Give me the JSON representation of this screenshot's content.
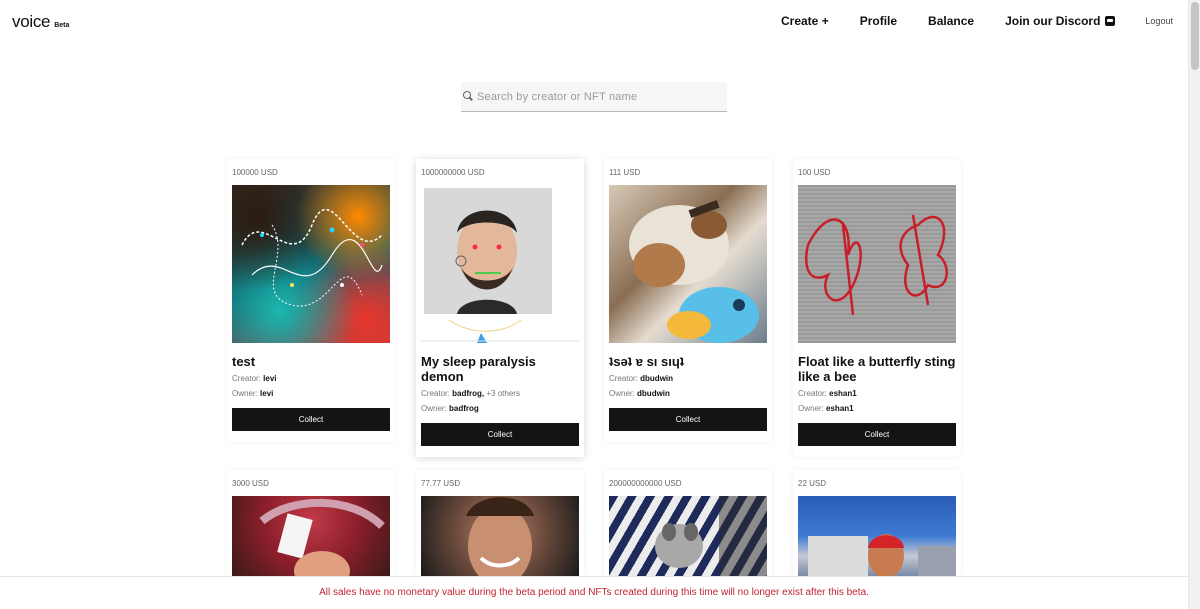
{
  "header": {
    "logo_text": "voice",
    "logo_badge": "Beta",
    "nav": {
      "create": "Create +",
      "profile": "Profile",
      "balance": "Balance",
      "discord": "Join our Discord",
      "logout": "Logout"
    }
  },
  "search": {
    "placeholder": "Search by creator or NFT name",
    "value": ""
  },
  "cards": [
    {
      "price": "100000 USD",
      "title": "test",
      "creator_label": "Creator:",
      "creator": "levi",
      "creator_more": "",
      "owner_label": "Owner:",
      "owner": "levi",
      "button": "Collect",
      "image": "abstract-art"
    },
    {
      "price": "1000000000 USD",
      "title": "My sleep paralysis demon",
      "creator_label": "Creator:",
      "creator": "badfrog,",
      "creator_more": "+3 others",
      "owner_label": "Owner:",
      "owner": "badfrog",
      "button": "Collect",
      "image": "face-portrait"
    },
    {
      "price": "111 USD",
      "title": "ʇsǝʇ ɐ sı sıɥʇ",
      "creator_label": "Creator:",
      "creator": "dbudwin",
      "creator_more": "",
      "owner_label": "Owner:",
      "owner": "dbudwin",
      "button": "Collect",
      "image": "dog-photo"
    },
    {
      "price": "100 USD",
      "title": "Float like a butterfly sting like a bee",
      "creator_label": "Creator:",
      "creator": "eshan1",
      "creator_more": "",
      "owner_label": "Owner:",
      "owner": "eshan1",
      "button": "Collect",
      "image": "butterfly-embroidery"
    },
    {
      "price": "3000 USD",
      "image": "hat-photo"
    },
    {
      "price": "77.77 USD",
      "image": "girl-portrait"
    },
    {
      "price": "200000000000 USD",
      "image": "pug-photo"
    },
    {
      "price": "22 USD",
      "image": "city-photo"
    }
  ],
  "footer": {
    "notice": "All sales have no monetary value during the beta period and NFTs created during this time will no longer exist after this beta."
  },
  "colors": {
    "button_bg": "#141414",
    "notice_red": "#c0262d"
  }
}
